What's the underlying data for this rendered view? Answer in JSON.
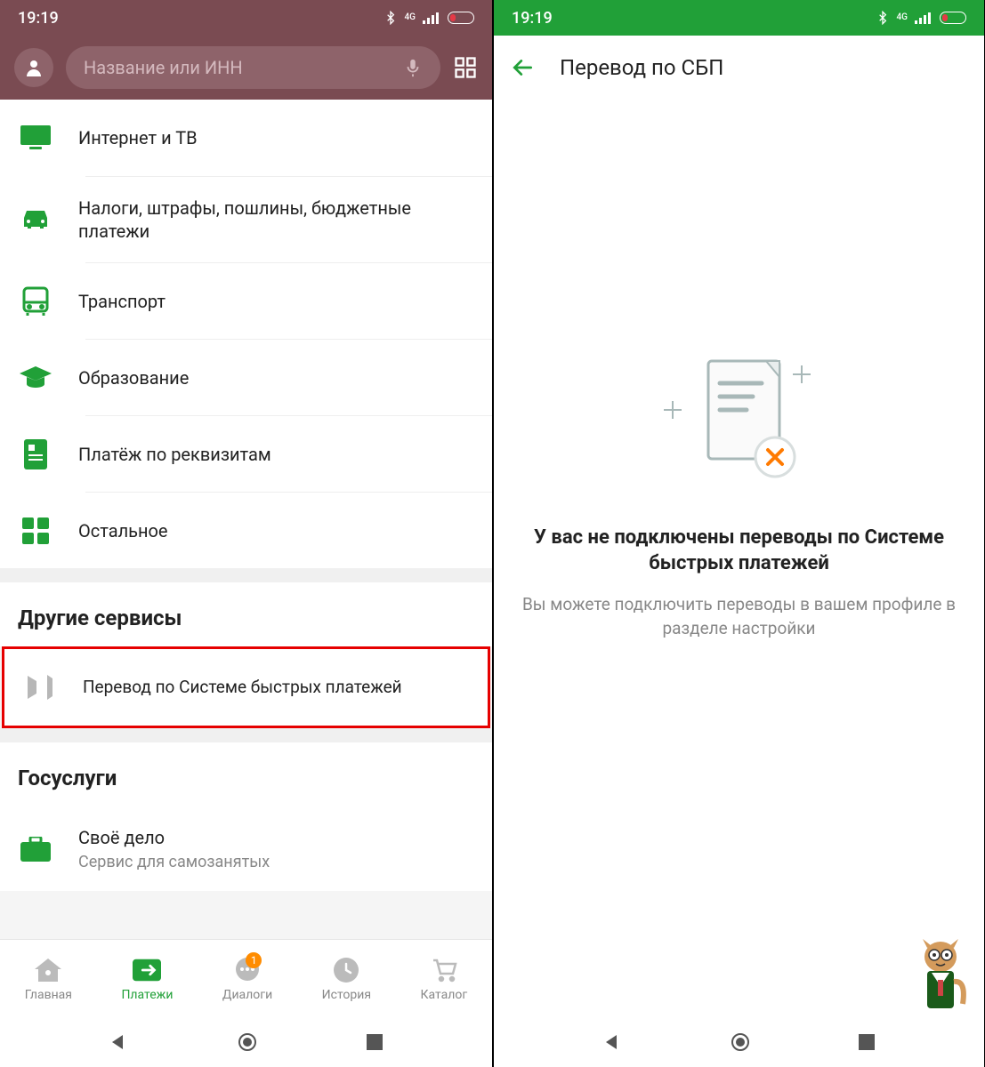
{
  "status": {
    "time": "19:19",
    "net_label": "4G"
  },
  "left": {
    "search_placeholder": "Название или ИНН",
    "categories": [
      {
        "icon": "tv",
        "label": "Интернет и ТВ"
      },
      {
        "icon": "car",
        "label": "Налоги, штрафы, пошлины, бюджетные платежи"
      },
      {
        "icon": "bus",
        "label": "Транспорт"
      },
      {
        "icon": "grad",
        "label": "Образование"
      },
      {
        "icon": "doc",
        "label": "Платёж по реквизитам"
      },
      {
        "icon": "grid",
        "label": "Остальное"
      }
    ],
    "section_other": "Другие сервисы",
    "sbp_item": "Перевод по Системе быстрых платежей",
    "section_gos": "Госуслуги",
    "gos_item": {
      "label": "Своё дело",
      "sub": "Сервис для самозанятых"
    },
    "nav": [
      {
        "label": "Главная"
      },
      {
        "label": "Платежи"
      },
      {
        "label": "Диалоги",
        "badge": "1"
      },
      {
        "label": "История"
      },
      {
        "label": "Каталог"
      }
    ]
  },
  "right": {
    "title": "Перевод по СБП",
    "empty_title": "У вас не подключены переводы по Системе быстрых платежей",
    "empty_sub": "Вы можете подключить переводы в вашем профиле в разделе настройки"
  }
}
